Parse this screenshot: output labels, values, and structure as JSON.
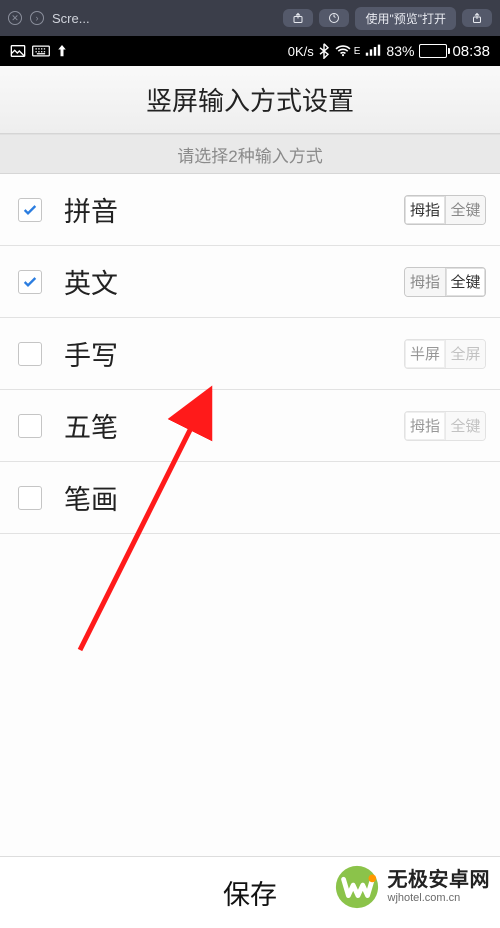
{
  "browser": {
    "tab_title": "Scre...",
    "open_with_text": "使用\"预览\"打开"
  },
  "android_status": {
    "speed": "0K/s",
    "battery_pct": "83%",
    "battery_level": 83,
    "time": "08:38"
  },
  "header": {
    "title": "竖屏输入方式设置"
  },
  "hint": {
    "text": "请选择2种输入方式"
  },
  "segments": {
    "thumb": "拇指",
    "fullkey": "全键",
    "halfscreen": "半屏",
    "fullscreen": "全屏"
  },
  "rows": [
    {
      "id": "pinyin",
      "label": "拼音",
      "checked": true,
      "seg": {
        "type": "thumb-fullkey",
        "active": 0,
        "disabled": false
      }
    },
    {
      "id": "english",
      "label": "英文",
      "checked": true,
      "seg": {
        "type": "thumb-fullkey",
        "active": 1,
        "disabled": false
      }
    },
    {
      "id": "handwriting",
      "label": "手写",
      "checked": false,
      "seg": {
        "type": "half-full",
        "active": 0,
        "disabled": true
      }
    },
    {
      "id": "wubi",
      "label": "五笔",
      "checked": false,
      "seg": {
        "type": "thumb-fullkey",
        "active": 0,
        "disabled": true
      }
    },
    {
      "id": "stroke",
      "label": "笔画",
      "checked": false,
      "seg": null
    }
  ],
  "save": {
    "label": "保存"
  },
  "watermark": {
    "name": "无极安卓网",
    "domain": "wjhotel.com.cn"
  }
}
